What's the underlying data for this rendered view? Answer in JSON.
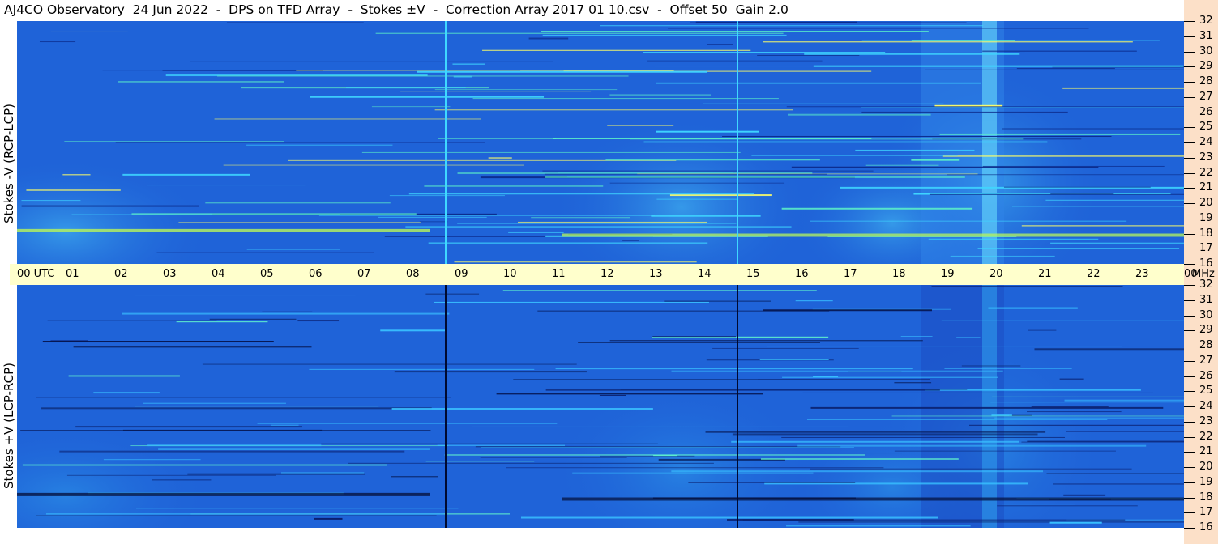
{
  "header": {
    "title": "AJ4CO Observatory  24 Jun 2022  -  DPS on TFD Array  -  Stokes ±V  -  Correction Array 2017 01 10.csv  -  Offset 50  Gain 2.0"
  },
  "colors": {
    "background_blue": "#1f63d8",
    "cyan_bright": "#47c6ff",
    "axis_band": "#ffffcc",
    "right_strip": "#fce0c8"
  },
  "chart_data": [
    {
      "type": "heatmap",
      "title": "AJ4CO Observatory  24 Jun 2022  -  DPS on TFD Array  -  Stokes ±V  -  Correction Array 2017 01 10.csv  -  Offset 50  Gain 2.0",
      "ylabel": "Stokes -V (RCP-LCP)",
      "xunit": "UTC",
      "yunit": "MHz",
      "xlim": [
        0,
        24
      ],
      "ylim": [
        16,
        32
      ],
      "x_ticks": [
        "00 UTC",
        "01",
        "02",
        "03",
        "04",
        "05",
        "06",
        "07",
        "08",
        "09",
        "10",
        "11",
        "12",
        "13",
        "14",
        "15",
        "16",
        "17",
        "18",
        "19",
        "20",
        "21",
        "22",
        "23",
        "00"
      ],
      "y_ticks": [
        "16",
        "17",
        "18",
        "19",
        "20",
        "21",
        "22",
        "23",
        "24",
        "25",
        "26",
        "27",
        "28",
        "29",
        "30",
        "31",
        "32"
      ],
      "markers_hours": [
        8.8,
        14.8
      ],
      "marker_style": "cyan"
    },
    {
      "type": "heatmap",
      "ylabel": "Stokes +V (LCP-RCP)",
      "xunit": "UTC",
      "yunit": "MHz",
      "xlim": [
        0,
        24
      ],
      "ylim": [
        16,
        32
      ],
      "x_ticks": [
        "00 UTC",
        "01",
        "02",
        "03",
        "04",
        "05",
        "06",
        "07",
        "08",
        "09",
        "10",
        "11",
        "12",
        "13",
        "14",
        "15",
        "16",
        "17",
        "18",
        "19",
        "20",
        "21",
        "22",
        "23",
        "00"
      ],
      "y_ticks": [
        "16",
        "17",
        "18",
        "19",
        "20",
        "21",
        "22",
        "23",
        "24",
        "25",
        "26",
        "27",
        "28",
        "29",
        "30",
        "31",
        "32"
      ],
      "markers_hours": [
        8.8,
        14.8
      ],
      "marker_style": "black"
    }
  ]
}
